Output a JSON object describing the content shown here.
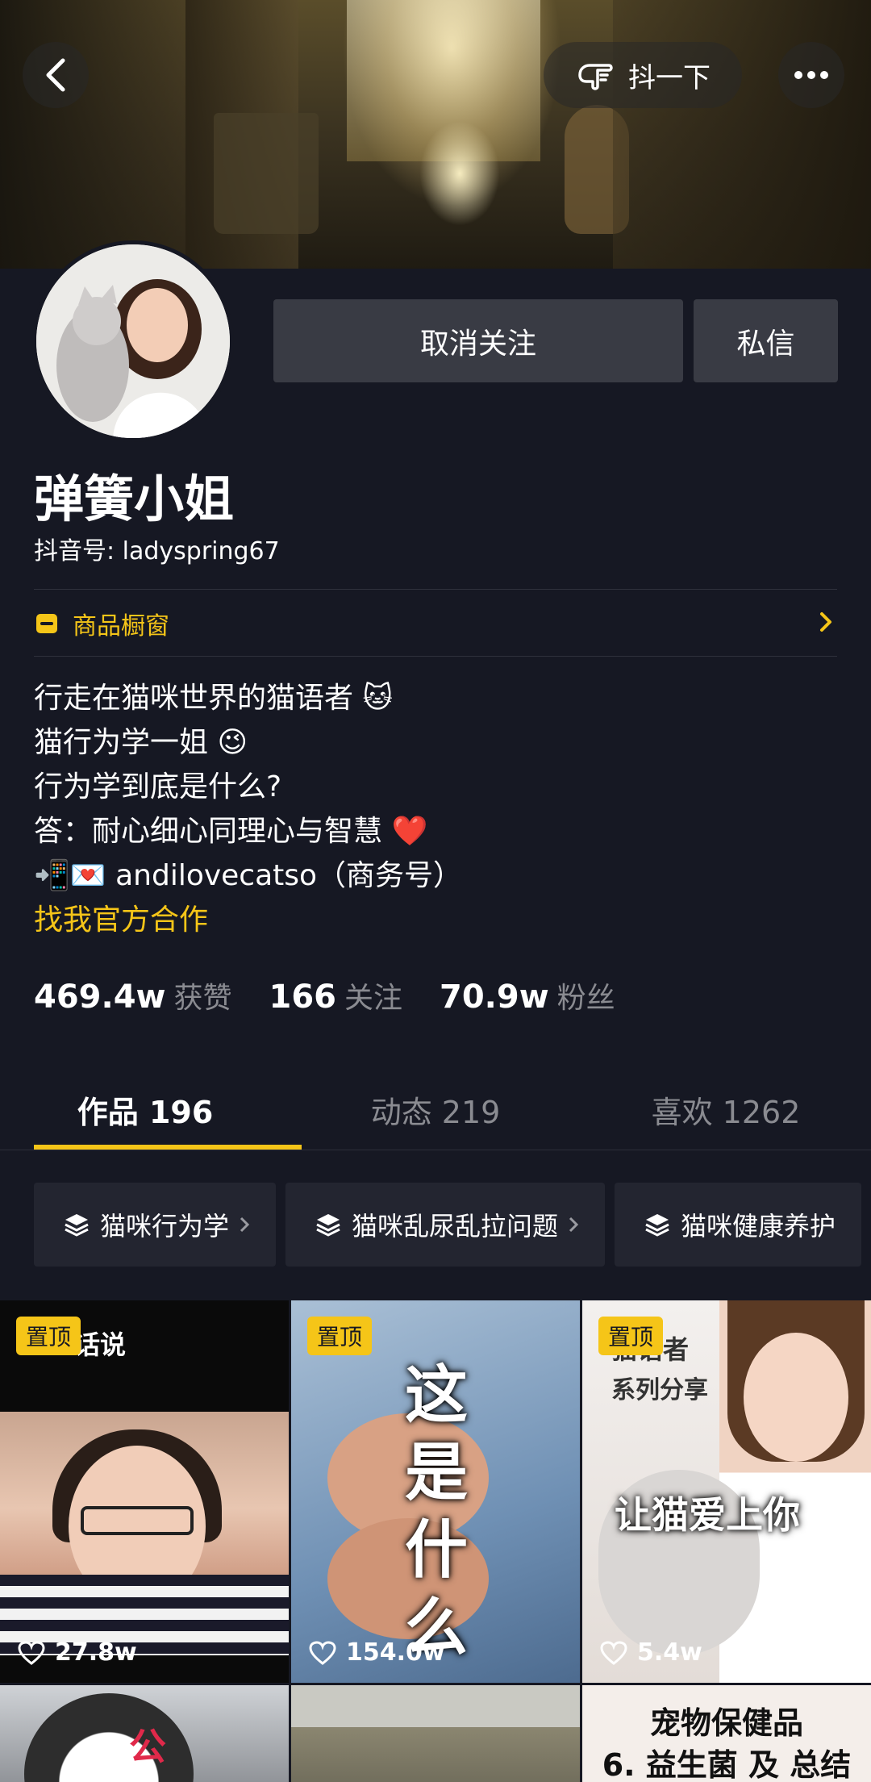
{
  "top_bar": {
    "shake_label": "抖一下"
  },
  "profile": {
    "name": "弹簧小姐",
    "handle": "抖音号: ladyspring67",
    "unfollow_label": "取消关注",
    "message_label": "私信",
    "shop_label": "商品橱窗",
    "bio": [
      "行走在猫咪世界的猫语者 🐱",
      "猫行为学一姐 😉",
      "行为学到底是什么?",
      "答：耐心细心同理心与智慧 ❤️",
      "📲💌 andilovecatso（商务号）"
    ],
    "cta": "找我官方合作"
  },
  "stats": [
    {
      "num": "469.4w",
      "label": "获赞"
    },
    {
      "num": "166",
      "label": "关注"
    },
    {
      "num": "70.9w",
      "label": "粉丝"
    }
  ],
  "tabs": [
    {
      "label": "作品 196",
      "active": true
    },
    {
      "label": "动态 219",
      "active": false
    },
    {
      "label": "喜欢 1262",
      "active": false
    }
  ],
  "collections": [
    "猫咪行为学",
    "猫咪乱尿乱拉问题",
    "猫咪健康养护"
  ],
  "videos": [
    {
      "pinned": "置顶",
      "likes": "27.8w",
      "overlay": "话说"
    },
    {
      "pinned": "置顶",
      "likes": "154.0w",
      "overlay": "这是什么"
    },
    {
      "pinned": "置顶",
      "likes": "5.4w",
      "overlay_1": "猫语者",
      "overlay_2": "系列分享",
      "overlay_3": "让猫爱上你"
    },
    {
      "overlay": "公"
    },
    {},
    {
      "overlay_1": "宠物保健品",
      "overlay_2": "6. 益生菌 及 总结"
    }
  ],
  "colors": {
    "background": "#161823",
    "accent": "#f5c518",
    "button": "#393b44",
    "muted": "#8a8b91"
  }
}
